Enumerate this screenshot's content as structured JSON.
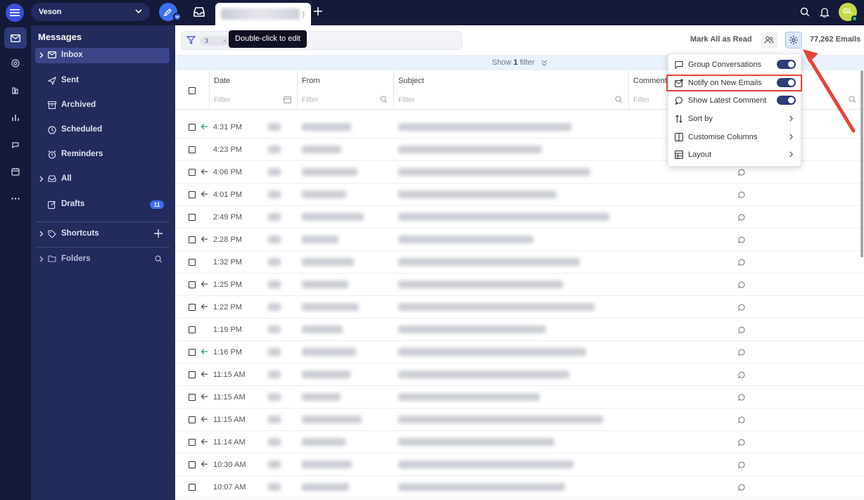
{
  "topbar": {
    "workspace": "Veson",
    "avatar_initials": "GL",
    "add_tab": "+"
  },
  "sidebar": {
    "title": "Messages",
    "items": [
      {
        "label": "Inbox",
        "icon": "envelope-icon",
        "active": true,
        "expandable": true
      },
      {
        "label": "Sent",
        "icon": "send-icon"
      },
      {
        "label": "Archived",
        "icon": "archive-icon"
      },
      {
        "label": "Scheduled",
        "icon": "clock-icon"
      },
      {
        "label": "Reminders",
        "icon": "alarm-icon"
      },
      {
        "label": "All",
        "icon": "inbox-stack-icon",
        "expandable": true
      },
      {
        "label": "Drafts",
        "icon": "edit-icon",
        "badge": "11"
      }
    ],
    "shortcuts": "Shortcuts",
    "folders": "Folders"
  },
  "toolbar": {
    "filter_count": "3",
    "tooltip": "Double-click to edit",
    "mark_all_read": "Mark All as Read",
    "email_count": "77,262 Emails",
    "show_filter_prefix": "Show",
    "show_filter_count": "1",
    "show_filter_suffix": "filter"
  },
  "columns": {
    "date": "Date",
    "from": "From",
    "subject": "Subject",
    "comment": "Comment",
    "filter_placeholder": "Filter"
  },
  "rows": [
    {
      "time": "4:31 PM",
      "arrow": "green"
    },
    {
      "time": "4:23 PM",
      "arrow": "none"
    },
    {
      "time": "4:06 PM",
      "arrow": "gray"
    },
    {
      "time": "4:01 PM",
      "arrow": "gray"
    },
    {
      "time": "2:49 PM",
      "arrow": "none"
    },
    {
      "time": "2:28 PM",
      "arrow": "gray"
    },
    {
      "time": "1:32 PM",
      "arrow": "none"
    },
    {
      "time": "1:25 PM",
      "arrow": "gray"
    },
    {
      "time": "1:22 PM",
      "arrow": "gray"
    },
    {
      "time": "1:19 PM",
      "arrow": "none"
    },
    {
      "time": "1:16 PM",
      "arrow": "green"
    },
    {
      "time": "11:15 AM",
      "arrow": "gray"
    },
    {
      "time": "11:15 AM",
      "arrow": "gray"
    },
    {
      "time": "11:15 AM",
      "arrow": "gray"
    },
    {
      "time": "11:14 AM",
      "arrow": "gray"
    },
    {
      "time": "10:30 AM",
      "arrow": "gray"
    },
    {
      "time": "10:07 AM",
      "arrow": "none"
    }
  ],
  "settings_menu": {
    "items": [
      {
        "label": "Group Conversations",
        "icon": "chat-icon",
        "toggle": true
      },
      {
        "label": "Notify on New Emails",
        "icon": "mail-notify-icon",
        "toggle": true
      },
      {
        "label": "Show Latest Comment",
        "icon": "comment-icon",
        "toggle": true
      },
      {
        "label": "Sort by",
        "icon": "sort-icon",
        "submenu": true
      },
      {
        "label": "Customise Columns",
        "icon": "columns-icon",
        "submenu": true
      },
      {
        "label": "Layout",
        "icon": "layout-icon",
        "submenu": true
      }
    ]
  },
  "colors": {
    "topbar": "#151a38",
    "sidebar": "#232a5c",
    "accent": "#3b6ef0",
    "toggle_on": "#2f3d78",
    "annotation": "#e8443a"
  }
}
